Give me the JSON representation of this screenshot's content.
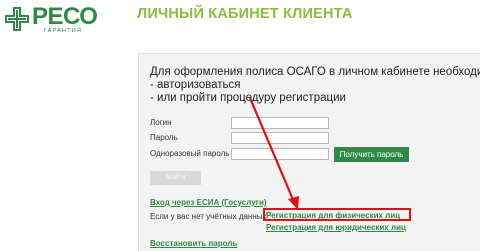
{
  "logo": {
    "name": "РЕСО",
    "sub": "ГАРАНТИЯ"
  },
  "page_title": "ЛИЧНЫЙ КАБИНЕТ КЛИЕНТА",
  "intro": {
    "line1": "Для оформления полиса ОСАГО в личном кабинете необходимо",
    "line2": "- авторизоваться",
    "line3": "- или пройти процедуру регистрации"
  },
  "form": {
    "login_label": "Логин",
    "password_label": "Пароль",
    "otp_label": "Одноразовый пароль",
    "login_value": "",
    "password_value": "",
    "otp_value": "",
    "get_password_button": "Получить пароль",
    "submit_button": "Войти"
  },
  "links": {
    "esia": "Вход через ЕСИА (Госуслуги)",
    "no_account_text": "Если у вас нет учётных данных",
    "register_individuals": "Регистрация для физических лиц",
    "register_legal": "Регистрация для юридических лиц",
    "restore_password": "Восстановить пароль"
  },
  "colors": {
    "brand_green": "#2f8a46",
    "title_green": "#86c23a",
    "highlight_red": "#e01010"
  }
}
